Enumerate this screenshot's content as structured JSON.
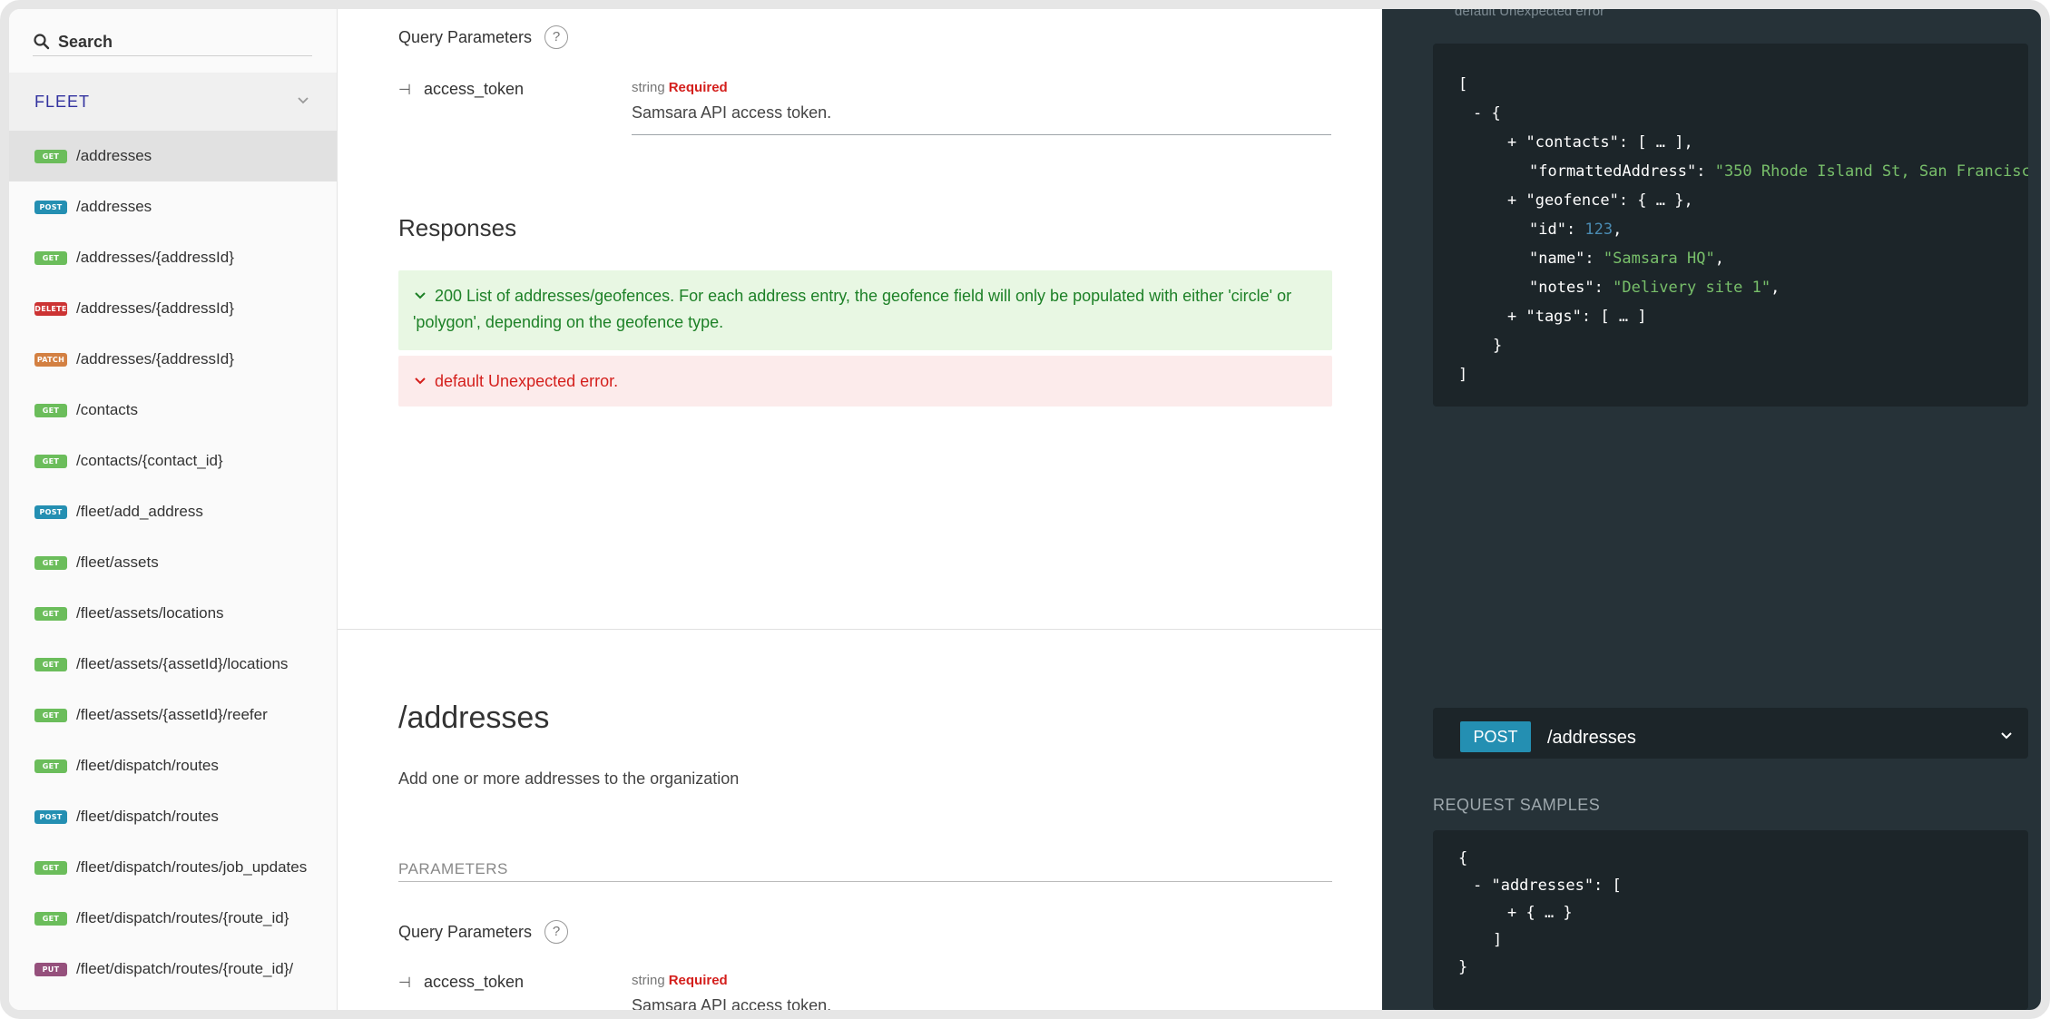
{
  "search": {
    "label": "Search"
  },
  "sidebar": {
    "group": "FLEET",
    "items": [
      {
        "method": "GET",
        "path": "/addresses",
        "active": true
      },
      {
        "method": "POST",
        "path": "/addresses"
      },
      {
        "method": "GET",
        "path": "/addresses/{addressId}"
      },
      {
        "method": "DELETE",
        "path": "/addresses/{addressId}"
      },
      {
        "method": "PATCH",
        "path": "/addresses/{addressId}"
      },
      {
        "method": "GET",
        "path": "/contacts"
      },
      {
        "method": "GET",
        "path": "/contacts/{contact_id}"
      },
      {
        "method": "POST",
        "path": "/fleet/add_address"
      },
      {
        "method": "GET",
        "path": "/fleet/assets"
      },
      {
        "method": "GET",
        "path": "/fleet/assets/locations"
      },
      {
        "method": "GET",
        "path": "/fleet/assets/{assetId}/locations"
      },
      {
        "method": "GET",
        "path": "/fleet/assets/{assetId}/reefer"
      },
      {
        "method": "GET",
        "path": "/fleet/dispatch/routes"
      },
      {
        "method": "POST",
        "path": "/fleet/dispatch/routes"
      },
      {
        "method": "GET",
        "path": "/fleet/dispatch/routes/job_updates"
      },
      {
        "method": "GET",
        "path": "/fleet/dispatch/routes/{route_id}"
      },
      {
        "method": "PUT",
        "path": "/fleet/dispatch/routes/{route_id}/"
      }
    ]
  },
  "main": {
    "query_params_label": "Query Parameters",
    "help_glyph": "?",
    "param": {
      "name": "access_token",
      "type": "string",
      "required": "Required",
      "description": "Samsara API access token."
    },
    "responses_title": "Responses",
    "response_ok": "200 List of addresses/geofences. For each address entry, the geofence field will only be populated with either 'circle' or 'polygon', depending on the geofence type.",
    "response_err": "default Unexpected error.",
    "endpoint2": {
      "title": "/addresses",
      "description": "Add one or more addresses to the organization",
      "params_label": "PARAMETERS",
      "query_params_label": "Query Parameters",
      "param_name": "access_token",
      "param_type": "string",
      "param_required": "Required",
      "param_description": "Samsara API access token."
    }
  },
  "right": {
    "top_cut_text": "default Unexpected error",
    "post_method": "POST",
    "post_path": "/addresses",
    "request_samples": "REQUEST SAMPLES"
  }
}
